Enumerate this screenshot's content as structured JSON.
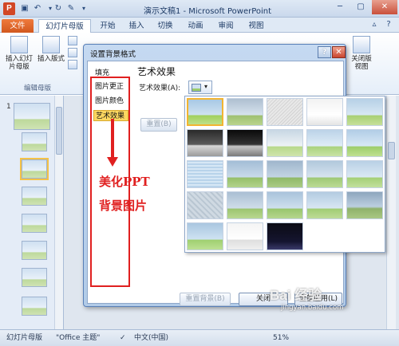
{
  "app": {
    "logo_letter": "P",
    "title": "演示文稿1 - Microsoft PowerPoint",
    "brand_color": "#d24726"
  },
  "quick_access": {
    "icons": [
      "save-icon",
      "undo-icon",
      "redo-icon",
      "customize-icon"
    ]
  },
  "tabs": [
    {
      "label": "文件"
    },
    {
      "label": "幻灯片母版"
    },
    {
      "label": "开始"
    },
    {
      "label": "插入"
    },
    {
      "label": "切换"
    },
    {
      "label": "动画"
    },
    {
      "label": "审阅"
    },
    {
      "label": "视图"
    }
  ],
  "ribbon": {
    "insert_slide_master": "插入幻灯片母版",
    "insert_layout": "插入版式",
    "close_view": "关闭版视图",
    "group_edit": "编辑母版"
  },
  "slide_pane": {
    "first_slide_number": "1"
  },
  "dialog": {
    "title": "设置背景格式",
    "help_label": "?",
    "close_label": "✕",
    "categories": [
      {
        "label": "填充"
      },
      {
        "label": "图片更正"
      },
      {
        "label": "图片颜色"
      },
      {
        "label": "艺术效果"
      }
    ],
    "selected_category": "艺术效果",
    "section_title": "艺术效果",
    "effect_label": "艺术效果(A):",
    "reset_button": "重置(B)",
    "reset_background_button": "重置背景(B)",
    "close_button": "关闭",
    "apply_all_button": "全部应用(L)"
  },
  "annotation": {
    "line1": "美化PPT",
    "line2": "背景图片",
    "color": "#e02020"
  },
  "statusbar": {
    "view": "幻灯片母版",
    "theme": "\"Office 主题\"",
    "language": "中文(中国)",
    "zoom": "51%"
  },
  "watermark": {
    "brand": "Bai 经验",
    "url": "jingyan.baidu.com"
  }
}
